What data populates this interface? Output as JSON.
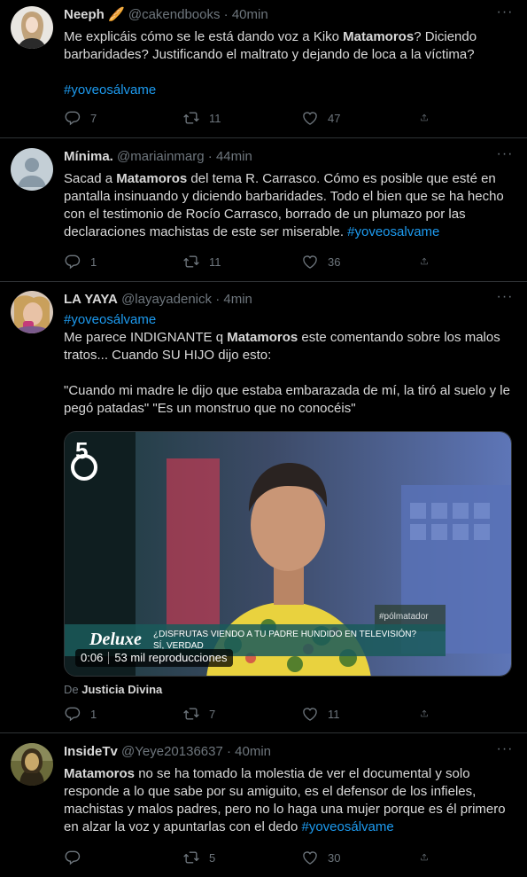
{
  "tweets": [
    {
      "name": "Neeph 🥖",
      "handle": "@cakendbooks",
      "dot": "·",
      "time": "40min",
      "text_parts": [
        "Me explicáis cómo se le está dando voz a Kiko ",
        "Matamoros",
        "? Diciendo barbaridades? Justificando el maltrato y dejando de loca a la víctima?"
      ],
      "hashtag": "#yoveosálvame",
      "replies": "7",
      "retweets": "11",
      "likes": "47"
    },
    {
      "name": "Mínima.",
      "handle": "@mariainmarg",
      "dot": "·",
      "time": "44min",
      "text_parts": [
        "Sacad a ",
        "Matamoros",
        " del tema R. Carrasco. Cómo es posible que esté en pantalla insinuando y diciendo barbaridades. Todo el bien que se ha hecho con el testimonio de Rocío Carrasco, borrado de un plumazo por las declaraciones machistas de este ser  miserable. "
      ],
      "hashtag": "#yoveosalvame",
      "replies": "1",
      "retweets": "11",
      "likes": "36"
    },
    {
      "name": "LA YAYA",
      "handle": "@layayadenick",
      "dot": "·",
      "time": "4min",
      "hashtag": "#yoveosálvame",
      "text_parts": [
        "Me parece INDIGNANTE q ",
        "Matamoros",
        " este comentando sobre los malos tratos... Cuando SU HIJO dijo esto:"
      ],
      "quote": "\"Cuando mi madre le dijo que estaba embarazada de mí, la tiró al suelo y le pegó patadas\" \"Es un monstruo que no conocéis\"",
      "video": {
        "duration": "0:06",
        "views": "53 mil reproducciones",
        "channel_logo": "5",
        "show_logo": "Deluxe",
        "caption_line1": "¿DISFRUTAS VIENDO A TU PADRE HUNDIDO EN TELEVISIÓN?",
        "caption_line2": "SÍ, VERDAD",
        "caption_icon": "¿",
        "watermark": "#pólmatador"
      },
      "from_label": "De",
      "from_source": "Justicia Divina",
      "replies": "1",
      "retweets": "7",
      "likes": "11"
    },
    {
      "name": "InsideTv",
      "handle": "@Yeye20136637",
      "dot": "·",
      "time": "40min",
      "text_parts": [
        "",
        "Matamoros",
        " no se ha tomado la molestia de ver el documental y solo responde a lo que sabe por su amiguito, es el defensor de los infieles, machistas y malos padres, pero no lo haga una mujer porque es él primero en alzar la voz y apuntarlas con el dedo "
      ],
      "hashtag": "#yoveosálvame",
      "replies": "",
      "retweets": "5",
      "likes": "30"
    }
  ],
  "icons": {
    "reply": "reply-icon",
    "retweet": "retweet-icon",
    "like": "heart-icon",
    "share": "share-icon",
    "more": "more-icon"
  },
  "colors": {
    "background": "#000000",
    "text": "#d9d9d9",
    "muted": "#6e767d",
    "link": "#1d9bf0",
    "divider": "#2f3336"
  }
}
